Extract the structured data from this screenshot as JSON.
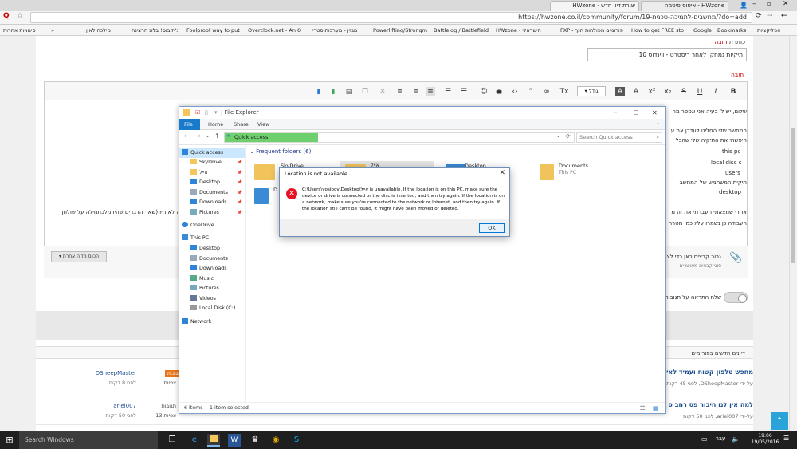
{
  "browser": {
    "tabs": [
      {
        "label": "יצירת דיון חדש - HWzone"
      },
      {
        "label": "HWzone - איפוס סיסמה"
      }
    ],
    "url": "https://hwzone.co.il/community/forum/19-מחשבים-לתמיכה-טכנית/?do=add",
    "profile_badge": "Q",
    "bookmarks": [
      {
        "label": "סימניות אחרות"
      },
      {
        "label": "מילכה לאון"
      },
      {
        "label": "צ'יקבוס! בלוג הרצינה"
      },
      {
        "label": "Foolproof way to put"
      },
      {
        "label": "Overclock.net - An O"
      },
      {
        "label": "מגזין - מערכות סטרי"
      },
      {
        "label": "Powerlifting/Strongm"
      },
      {
        "label": "Battlelog / Battlefield"
      },
      {
        "label": "HWzone - הישראלי"
      },
      {
        "label": "FXP - פורומים מפולחות חנך"
      },
      {
        "label": "How to get FREE sto"
      },
      {
        "label": "Google"
      },
      {
        "label": "Bookmarks"
      },
      {
        "label": "אפליקציות"
      }
    ]
  },
  "form": {
    "title_label": "כותרת",
    "title_required": "חובה",
    "title_value": "תיקיות נמחקו לאחר ריסטרט - ווינדוס 10",
    "content_required": "חובה",
    "font_size_label": "גודל",
    "editor_lines": [
      "שלום, יש לי בעיה אני אספר מה",
      "המחשב שלי החליט לעדכן את ע",
      "חיפשתי את התיקיה שלי שהכל",
      "this pc",
      "local disc c",
      "users",
      "תיקית המשתמש של המחשב",
      "desktop",
      "אחרי שמצאתי העברתי את זה מ",
      "העבודה כן נשמרו עליו כמו מטרה"
    ],
    "editor_right_fragment": "ה לא היו (שאר הדברים שהיו מלכתחילה על שולחן",
    "drag_text": "גרור קבצים כאן כדי לצרף",
    "allowed_files": "סוגי קבצים מאושרים",
    "insert_media_button": "הכנס מדיה אחרת",
    "notify_label": "שלח התראה על תגובות"
  },
  "forum": {
    "section_header": "דיונים חדשים בפורומים",
    "posts": [
      {
        "title": "מחפש טלפון קשוח ועמיד לאי",
        "author_line": "על-ידי DSheepMaster, לפני 45 דקות",
        "last_user": "DSheepMaster",
        "last_time": "לפני 8 דקות",
        "tag": "תגובות",
        "views": "צפיות"
      },
      {
        "title": "למה אין לנו חיבור פס רחב ס",
        "author_line": "על-ידי ariel007, לפני 50 דקות",
        "last_user": "ariel007",
        "last_time": "לפני 50 דקות",
        "tag": "תגובות",
        "views": "צפיות 13"
      }
    ]
  },
  "explorer": {
    "title": "File Explorer",
    "ribbon_tabs": [
      "File",
      "Home",
      "Share",
      "View"
    ],
    "path": "Quick access",
    "search_placeholder": "Search Quick access",
    "sidebar": [
      {
        "label": "Quick access",
        "icon": "star-icon"
      },
      {
        "label": "SkyDrive",
        "icon": "folder-icon"
      },
      {
        "label": "אייל",
        "icon": "folder-icon"
      },
      {
        "label": "Desktop",
        "icon": "desktop-icon"
      },
      {
        "label": "Documents",
        "icon": "documents-icon"
      },
      {
        "label": "Downloads",
        "icon": "downloads-icon"
      },
      {
        "label": "Pictures",
        "icon": "pictures-icon"
      },
      {
        "label": "OneDrive",
        "icon": "cloud-icon"
      },
      {
        "label": "This PC",
        "icon": "pc-icon"
      },
      {
        "label": "Desktop",
        "icon": "desktop-icon"
      },
      {
        "label": "Documents",
        "icon": "documents-icon"
      },
      {
        "label": "Downloads",
        "icon": "downloads-icon"
      },
      {
        "label": "Music",
        "icon": "music-icon"
      },
      {
        "label": "Pictures",
        "icon": "pictures-icon"
      },
      {
        "label": "Videos",
        "icon": "videos-icon"
      },
      {
        "label": "Local Disk (C:)",
        "icon": "disk-icon"
      },
      {
        "label": "Network",
        "icon": "network-icon"
      }
    ],
    "frequent_header": "Frequent folders (6)",
    "folders": [
      {
        "name": "SkyDrive",
        "sub": ""
      },
      {
        "name": "אייל",
        "sub": ""
      },
      {
        "name": "Desktop",
        "sub": ""
      },
      {
        "name": "Documents",
        "sub": "This PC"
      },
      {
        "name": "D",
        "sub": ""
      }
    ],
    "status_items": "6 items",
    "status_selected": "1 item selected"
  },
  "dialog": {
    "title": "Location is not available",
    "message": "C:\\Users\\yosipov\\Desktop\\אייל is unavailable. If the location is on this PC, make sure the device or drive is connected or the disc is inserted, and then try again. If the location is on a network, make sure you're connected to the network or Internet, and then try again. If the location still can't be found, it might have been moved or deleted.",
    "ok_label": "OK"
  },
  "taskbar": {
    "search_placeholder": "Search Windows",
    "time": "19:06",
    "date": "19/05/2016",
    "lang": "עבר"
  },
  "colors": {
    "accent": "#1979ca",
    "error": "#e81123",
    "forum_link": "#1a4d8f",
    "tag": "#e8761f"
  }
}
